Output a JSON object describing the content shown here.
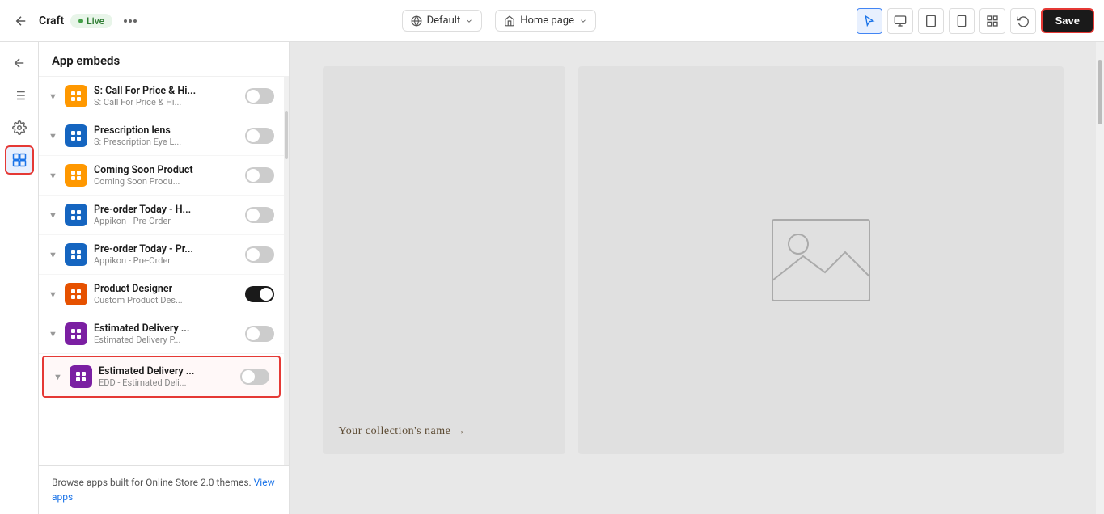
{
  "topbar": {
    "back_icon": "←",
    "store_name": "Craft",
    "live_label": "Live",
    "more_icon": "•••",
    "default_label": "Default",
    "default_icon": "🌐",
    "homepage_label": "Home page",
    "homepage_icon": "⌂",
    "view_icons": [
      "desktop",
      "tablet",
      "mobile",
      "grid"
    ],
    "undo_icon": "↩",
    "save_label": "Save"
  },
  "sidebar": {
    "title": "App embeds",
    "apps": [
      {
        "id": "call-for-price",
        "name": "S: Call For Price & Hi...",
        "subtitle": "S: Call For Price & Hi...",
        "icon_color": "orange",
        "icon_letter": "S",
        "toggle": false,
        "highlighted": false
      },
      {
        "id": "prescription-lens",
        "name": "Prescription lens",
        "subtitle": "S: Prescription Eye L...",
        "icon_color": "blue",
        "icon_letter": "P",
        "toggle": false,
        "highlighted": false
      },
      {
        "id": "coming-soon",
        "name": "Coming Soon Product",
        "subtitle": "Coming Soon Produ...",
        "icon_color": "orange",
        "icon_letter": "C",
        "toggle": false,
        "highlighted": false
      },
      {
        "id": "preorder-today-h",
        "name": "Pre-order Today - H...",
        "subtitle": "Appikon - Pre-Order",
        "icon_color": "blue",
        "icon_letter": "P",
        "toggle": false,
        "highlighted": false
      },
      {
        "id": "preorder-today-p",
        "name": "Pre-order Today - Pr...",
        "subtitle": "Appikon - Pre-Order",
        "icon_color": "blue",
        "icon_letter": "P",
        "toggle": false,
        "highlighted": false
      },
      {
        "id": "product-designer",
        "name": "Product Designer",
        "subtitle": "Custom Product Des...",
        "icon_color": "dark-orange",
        "icon_letter": "D",
        "toggle": true,
        "highlighted": false
      },
      {
        "id": "estimated-delivery-1",
        "name": "Estimated Delivery ...",
        "subtitle": "Estimated Delivery P...",
        "icon_color": "violet",
        "icon_letter": "E",
        "toggle": false,
        "highlighted": false
      },
      {
        "id": "estimated-delivery-2",
        "name": "Estimated Delivery ...",
        "subtitle": "EDD - Estimated Deli...",
        "icon_color": "violet",
        "icon_letter": "E",
        "toggle": false,
        "highlighted": true
      }
    ],
    "footer_text": "Browse apps built for Online Store 2.0 themes.",
    "footer_link": "View apps"
  },
  "canvas": {
    "collection_link": "Your collection's name →",
    "img_alt": "image placeholder"
  },
  "rail": {
    "icons": [
      "back",
      "menu",
      "gear",
      "apps"
    ]
  }
}
